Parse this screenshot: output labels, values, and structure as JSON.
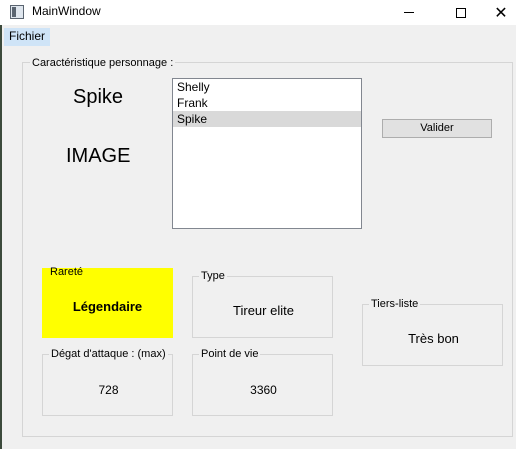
{
  "window": {
    "title": "MainWindow",
    "app_icon": "window-app-icon",
    "controls": {
      "minimize_icon": "minimize-icon",
      "maximize_icon": "maximize-icon",
      "close_icon": "close-icon",
      "close_glyph": "✕"
    }
  },
  "menu": {
    "items": [
      {
        "label": "Fichier"
      }
    ]
  },
  "group": {
    "title": "Caractéristique personnage :"
  },
  "character": {
    "name": "Spike",
    "image_placeholder": "IMAGE"
  },
  "list": {
    "items": [
      "Shelly",
      "Frank",
      "Spike"
    ],
    "selected_index": 2
  },
  "buttons": {
    "validate": "Valider"
  },
  "rarity": {
    "title": "Rareté",
    "value": "Légendaire",
    "color": "#ffff00"
  },
  "type": {
    "title": "Type",
    "value": "Tireur elite"
  },
  "tier": {
    "title": "Tiers-liste",
    "value": "Très bon"
  },
  "damage": {
    "title": "Dégat d'attaque : (max)",
    "value": "728"
  },
  "health": {
    "title": "Point de vie",
    "value": "3360"
  }
}
